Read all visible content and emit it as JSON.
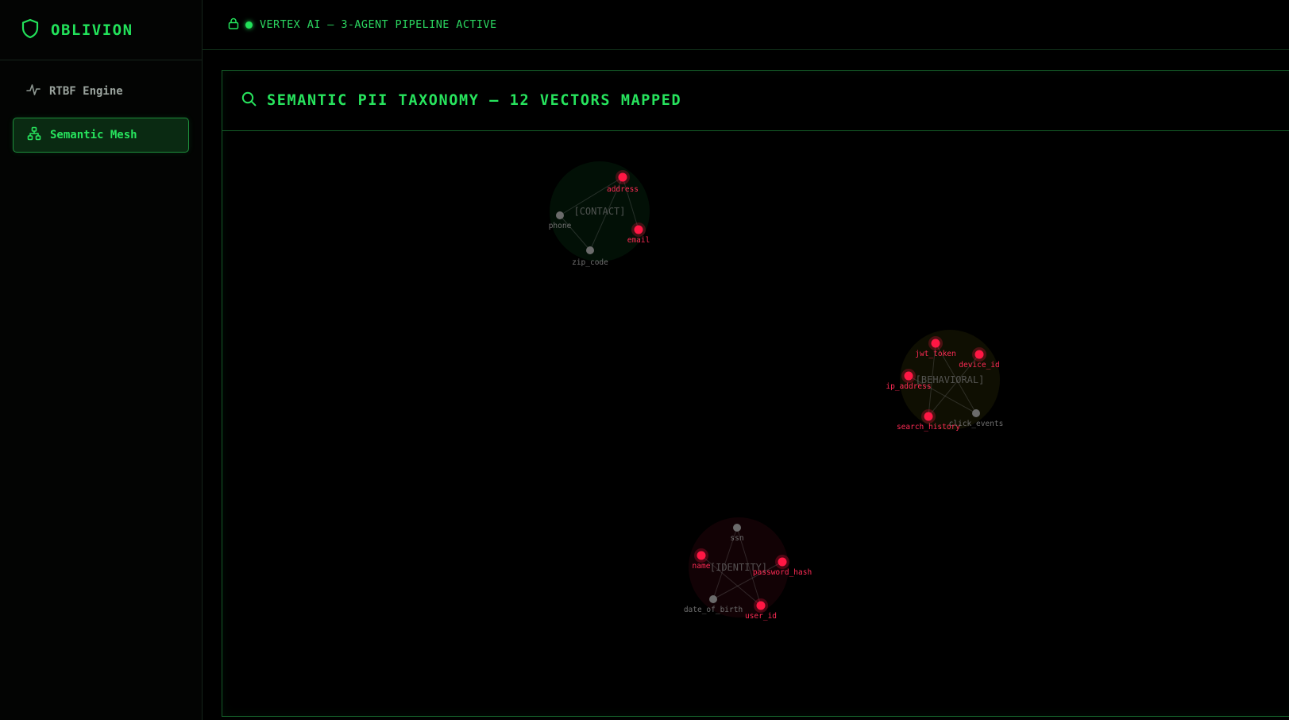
{
  "app": {
    "name": "OBLIVION"
  },
  "sidebar": {
    "items": [
      {
        "label": "RTBF Engine",
        "icon": "activity-icon",
        "active": false
      },
      {
        "label": "Semantic Mesh",
        "icon": "network-icon",
        "active": true
      }
    ]
  },
  "topbar": {
    "status": "VERTEX AI — 3-AGENT PIPELINE ACTIVE",
    "status_color": "#22e25a"
  },
  "panel": {
    "title": "SEMANTIC PII TAXONOMY — 12 VECTORS MAPPED",
    "icon": "search-icon"
  },
  "colors": {
    "accent": "#22e25a",
    "flagged": "#ff1744",
    "neutral": "#6b6b6b"
  },
  "graph": {
    "clusters": [
      {
        "id": "contact",
        "label": "[CONTACT]",
        "tint": "#22e25a",
        "nodes": [
          {
            "label": "address",
            "flagged": true
          },
          {
            "label": "phone",
            "flagged": false
          },
          {
            "label": "email",
            "flagged": true
          },
          {
            "label": "zip_code",
            "flagged": false
          }
        ]
      },
      {
        "id": "behavioral",
        "label": "[BEHAVIORAL]",
        "tint": "#d8d01e",
        "nodes": [
          {
            "label": "jwt_token",
            "flagged": true
          },
          {
            "label": "device_id",
            "flagged": true
          },
          {
            "label": "ip_address",
            "flagged": true
          },
          {
            "label": "search_history",
            "flagged": true
          },
          {
            "label": "click_events",
            "flagged": false
          }
        ]
      },
      {
        "id": "identity",
        "label": "[IDENTITY]",
        "tint": "#ff1744",
        "nodes": [
          {
            "label": "ssn",
            "flagged": false
          },
          {
            "label": "name",
            "flagged": true
          },
          {
            "label": "password_hash",
            "flagged": true
          },
          {
            "label": "date_of_birth",
            "flagged": false
          },
          {
            "label": "user_id",
            "flagged": true
          }
        ]
      }
    ]
  }
}
